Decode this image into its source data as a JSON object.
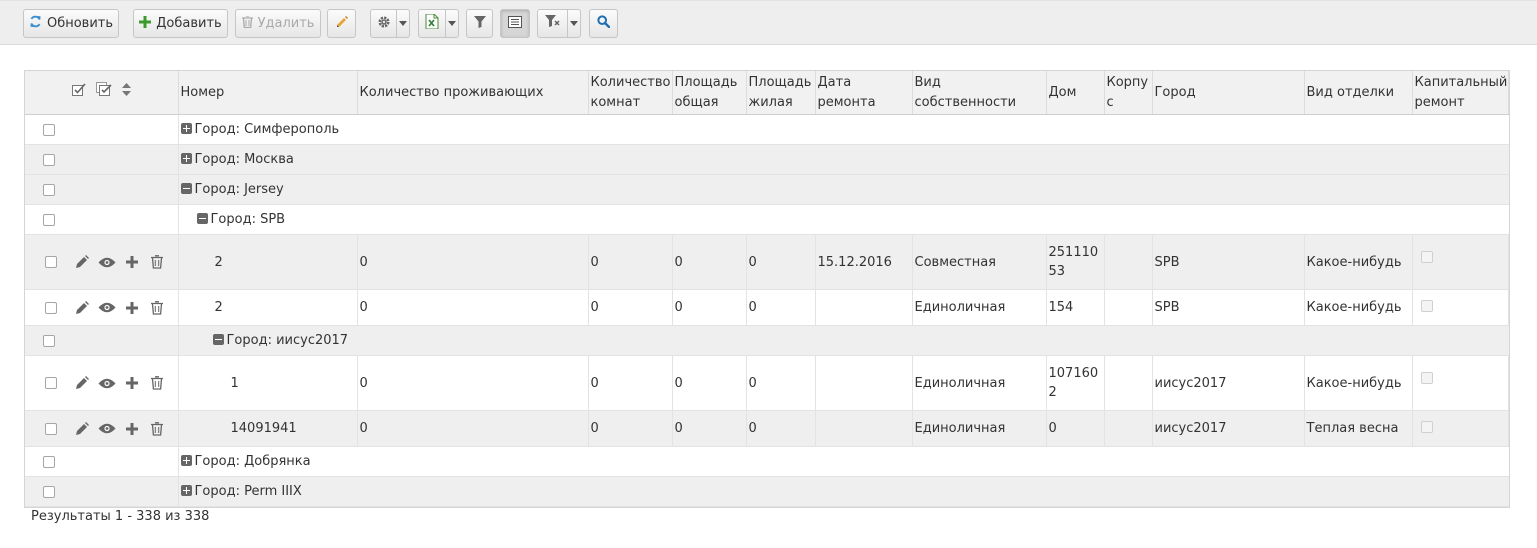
{
  "toolbar": {
    "refresh_label": "Обновить",
    "add_label": "Добавить",
    "delete_label": "Удалить"
  },
  "grid": {
    "columns": [
      "Номер",
      "Количество проживающих",
      "Количество комнат",
      "Площадь общая",
      "Площадь жилая",
      "Дата ремонта",
      "Вид собственности",
      "Дом",
      "Корпус",
      "Город",
      "Вид отделки",
      "Капитальный ремонт"
    ],
    "groups": {
      "g1": "Город: Симферополь",
      "g2": "Город: Москва",
      "g3": "Город: Jersey",
      "g3a": "Город: SPB",
      "g3b": "Город: иисус2017",
      "g4": "Город: Добрянка",
      "g5": "Город: Perm IIIX"
    },
    "rows": [
      [
        "2",
        "0",
        "0",
        "0",
        "0",
        "15.12.2016",
        "Совместная",
        "25111053",
        "",
        "SPB",
        "Какое-нибудь"
      ],
      [
        "2",
        "0",
        "0",
        "0",
        "0",
        "",
        "Единоличная",
        "154",
        "",
        "SPB",
        "Какое-нибудь"
      ],
      [
        "1",
        "0",
        "0",
        "0",
        "0",
        "",
        "Единоличная",
        "1071602",
        "",
        "иисус2017",
        "Какое-нибудь"
      ],
      [
        "14091941",
        "0",
        "0",
        "0",
        "0",
        "",
        "Единоличная",
        "0",
        "",
        "иисус2017",
        "Теплая весна"
      ]
    ]
  },
  "footer": {
    "results": "Результаты 1 - 338 из 338"
  },
  "colors": {
    "toolbar_bg": "#eeeeee",
    "alt_row": "#efefef",
    "header_bg": "#f1f1f1",
    "add_icon": "#3a9b2c",
    "search_icon": "#1f6fb2"
  }
}
